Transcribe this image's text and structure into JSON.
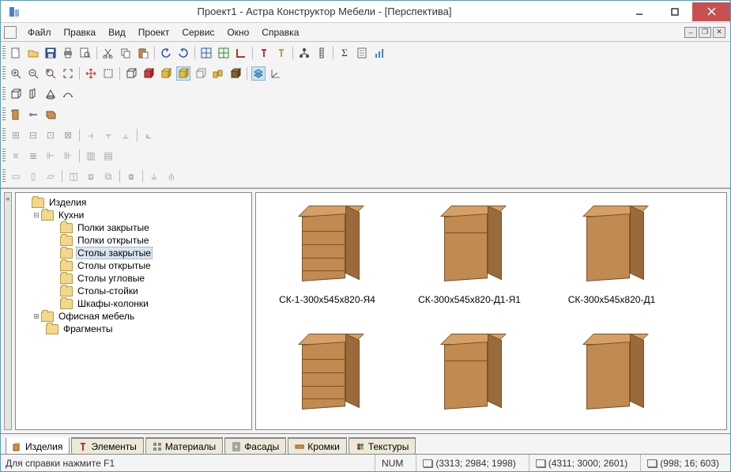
{
  "window": {
    "title": "Проект1 - Астра Конструктор Мебели - [Перспектива]"
  },
  "menu": {
    "file": "Файл",
    "edit": "Правка",
    "view": "Вид",
    "project": "Проект",
    "service": "Сервис",
    "window": "Окно",
    "help": "Справка"
  },
  "tree": {
    "root": "Изделия",
    "kitchens": "Кухни",
    "items": {
      "k0": "Полки закрытые",
      "k1": "Полки открытые",
      "k2": "Столы закрытые",
      "k3": "Столы открытые",
      "k4": "Столы угловые",
      "k5": "Столы-стойки",
      "k6": "Шкафы-колонки"
    },
    "office": "Офисная мебель",
    "fragments": "Фрагменты"
  },
  "gallery": {
    "g0": "СК-1-300х545х820-Я4",
    "g1": "СК-300х545х820-Д1-Я1",
    "g2": "СК-300х545х820-Д1"
  },
  "tabs": {
    "t0": "Изделия",
    "t1": "Элементы",
    "t2": "Материалы",
    "t3": "Фасады",
    "t4": "Кромки",
    "t5": "Текстуры"
  },
  "status": {
    "hint": "Для справки нажмите F1",
    "num": "NUM",
    "c1": "(3313; 2984; 1998)",
    "c2": "(4311; 3000; 2601)",
    "c3": "(998; 16; 603)"
  }
}
